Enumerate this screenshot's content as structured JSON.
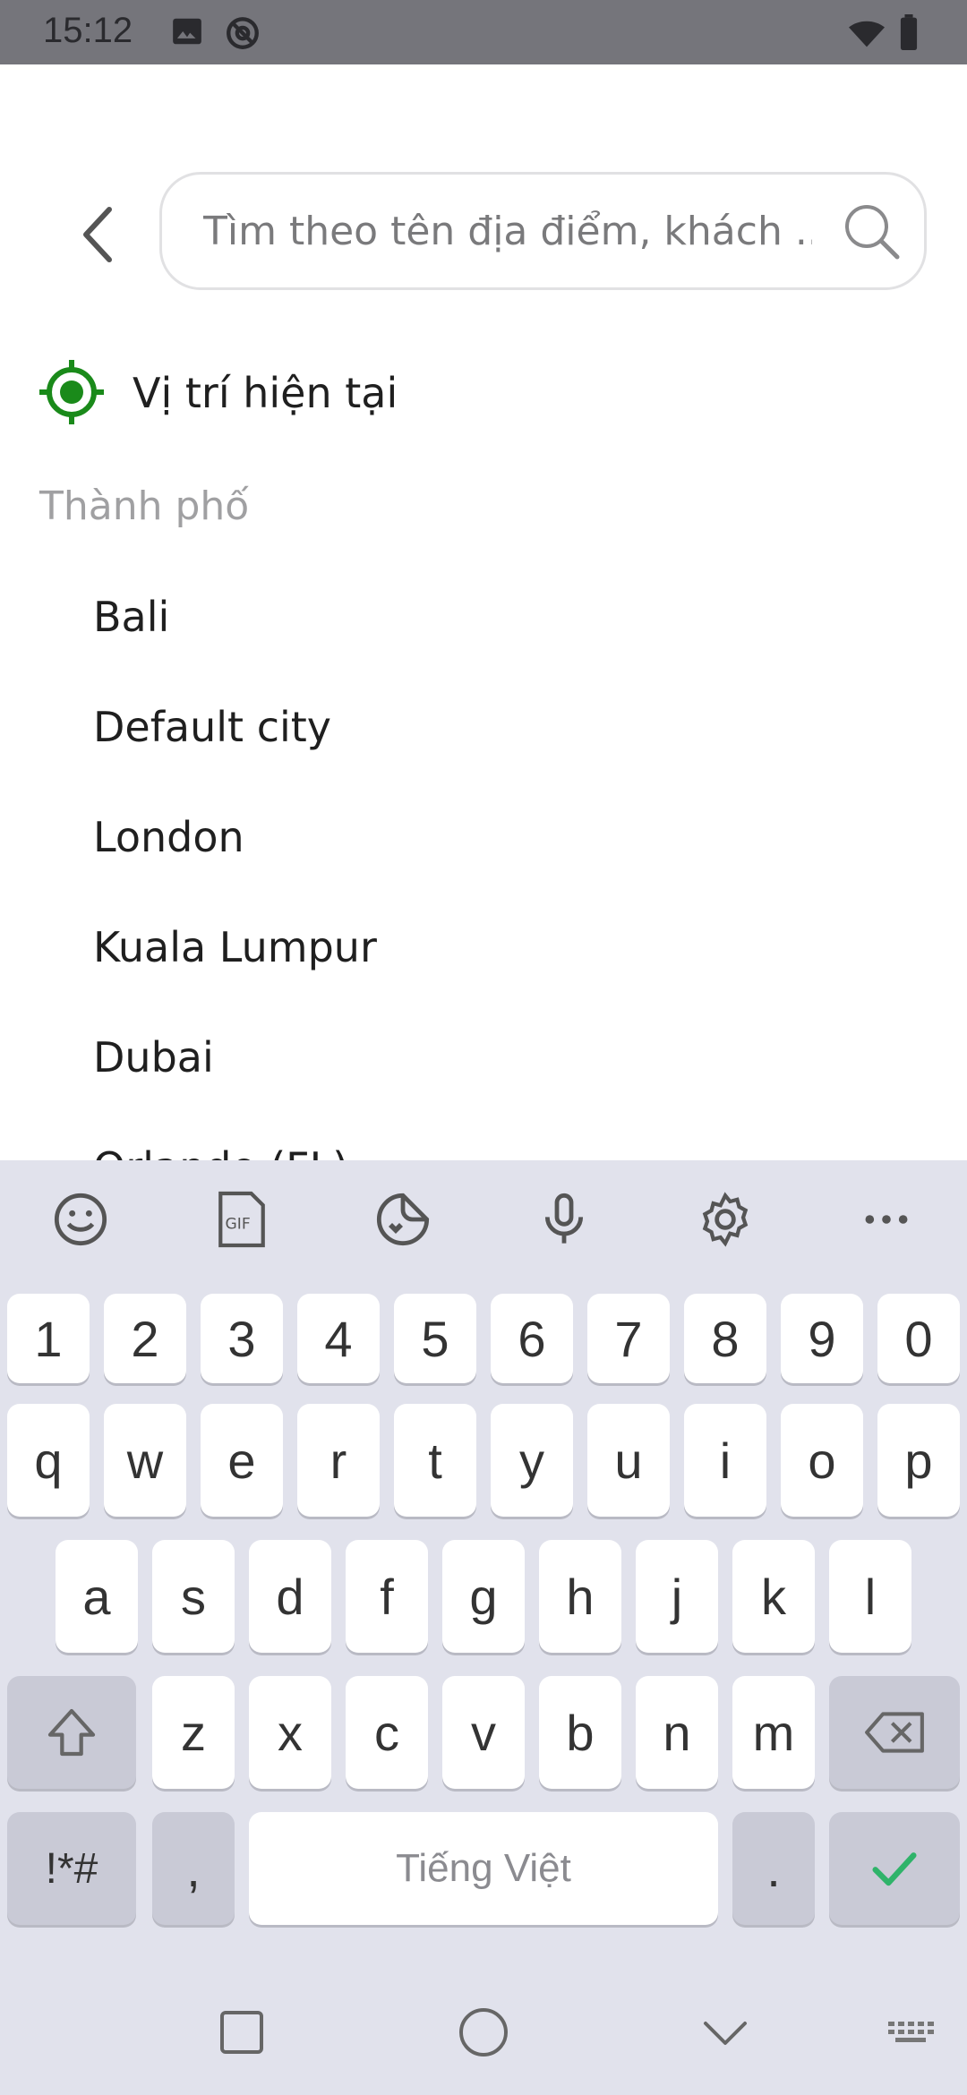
{
  "status_bar": {
    "time": "15:12",
    "icons": [
      "image-icon",
      "sync-icon",
      "wifi-icon",
      "battery-icon"
    ]
  },
  "search": {
    "placeholder": "Tìm theo tên địa điểm, khách ...",
    "value": ""
  },
  "current_location": {
    "label": "Vị trí hiện tại",
    "icon": "crosshair-icon",
    "color": "#1a8a1a"
  },
  "section": {
    "title": "Thành phố"
  },
  "cities": [
    "Bali",
    "Default city",
    "London",
    "Kuala Lumpur",
    "Dubai",
    "Orlando (FL)"
  ],
  "keyboard": {
    "toolbar": [
      "emoji-icon",
      "gif-icon",
      "sticker-icon",
      "mic-icon",
      "settings-icon",
      "more-icon"
    ],
    "row_numbers": [
      "1",
      "2",
      "3",
      "4",
      "5",
      "6",
      "7",
      "8",
      "9",
      "0"
    ],
    "row1": [
      "q",
      "w",
      "e",
      "r",
      "t",
      "y",
      "u",
      "i",
      "o",
      "p"
    ],
    "row2": [
      "a",
      "s",
      "d",
      "f",
      "g",
      "h",
      "j",
      "k",
      "l"
    ],
    "row3": [
      "z",
      "x",
      "c",
      "v",
      "b",
      "n",
      "m"
    ],
    "symbols_label": "!*#",
    "comma_label": ",",
    "space_label": "Tiếng Việt",
    "period_label": ".",
    "accent_color": "#2fb36a"
  },
  "nav": [
    "recents-icon",
    "home-icon",
    "back-icon",
    "keyboard-switch-icon"
  ]
}
